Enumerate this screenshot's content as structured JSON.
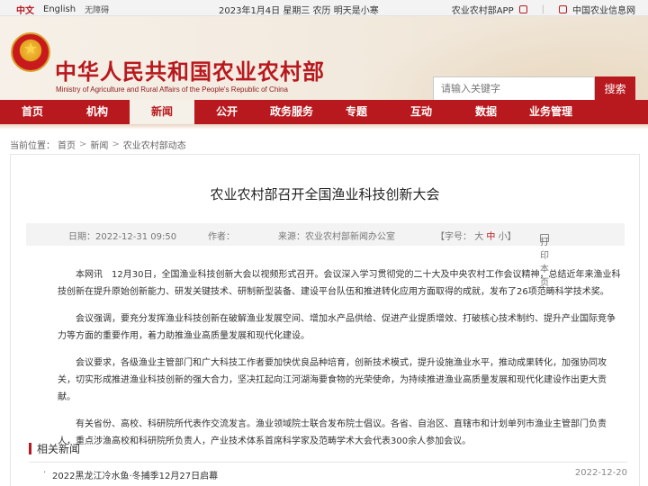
{
  "topbar": {
    "lang_cn": "中文",
    "lang_en": "English",
    "accessibility": "无障碍",
    "date": "2023年1月4日 星期三 农历 明天是小寒",
    "link_app": "农业农村部APP",
    "link_info": "中国农业信息网"
  },
  "banner": {
    "title_cn": "中华人民共和国农业农村部",
    "title_en": "Ministry of Agriculture and Rural Affairs of the People's Republic of China"
  },
  "search": {
    "placeholder": "请输入关键字",
    "button": "搜索"
  },
  "nav": [
    "首页",
    "机构",
    "新闻",
    "公开",
    "政务服务",
    "专题",
    "互动",
    "数据",
    "业务管理"
  ],
  "breadcrumb": {
    "label": "当前位置：",
    "items": [
      "首页",
      "新闻",
      "农业农村部动态"
    ]
  },
  "article": {
    "title": "农业农村部召开全国渔业科技创新大会",
    "date_label": "日期：2022-12-31 09:50",
    "author_label": "作者：",
    "source_label": "来源：农业农村部新闻办公室",
    "size_label": "【字号：",
    "size_large": "大",
    "size_mid": "中",
    "size_small": "小】",
    "print": "打印本页",
    "paragraphs": [
      "本网讯　12月30日，全国渔业科技创新大会以视频形式召开。会议深入学习贯彻党的二十大及中央农村工作会议精神，总结近年来渔业科技创新在提升原始创新能力、研发关键技术、研制新型装备、建设平台队伍和推进转化应用方面取得的成就，发布了26项范畴科学技术奖。",
      "会议强调，要充分发挥渔业科技创新在破解渔业发展空间、增加水产品供给、促进产业提质增效、打破核心技术制约、提升产业国际竞争力等方面的重要作用，着力助推渔业高质量发展和现代化建设。",
      "会议要求，各级渔业主管部门和广大科技工作者要加快优良品种培育，创新技术模式，提升设施渔业水平，推动成果转化，加强协同攻关，切实形成推进渔业科技创新的强大合力，坚决扛起向江河湖海要食物的光荣使命，为持续推进渔业高质量发展和现代化建设作出更大贡献。",
      "有关省份、高校、科研院所代表作交流发言。渔业领域院士联合发布院士倡议。各省、自治区、直辖市和计划单列市渔业主管部门负责人，重点涉渔高校和科研院所负责人，产业技术体系首席科学家及范畴学术大会代表300余人参加会议。"
    ]
  },
  "related": {
    "heading": "相关新闻",
    "items": [
      {
        "title": "2022黑龙江冷水鱼·冬捕季12月27日启幕",
        "date": "2022-12-20"
      }
    ]
  },
  "colors": {
    "brand_red": "#b8191e",
    "meta_bg": "#f3f3f3"
  }
}
